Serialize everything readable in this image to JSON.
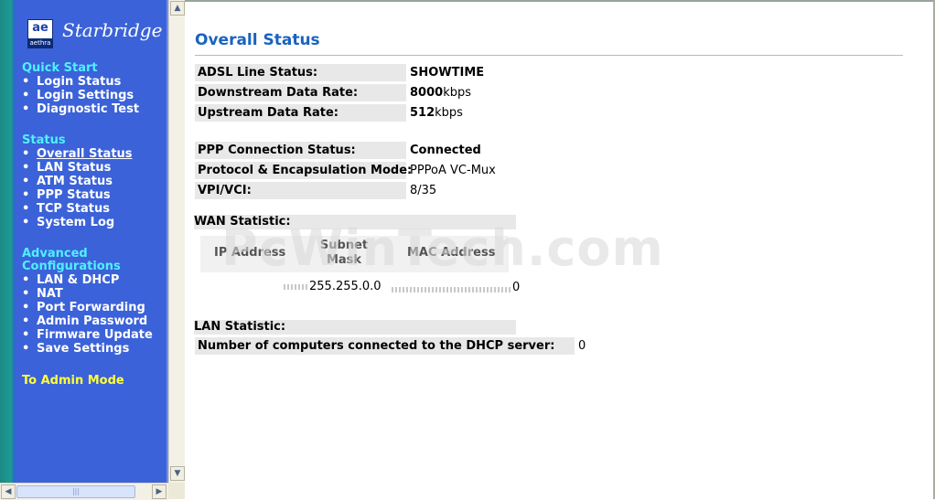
{
  "brand": {
    "logo_glyph": "ae",
    "logo_sub": "aethra",
    "name": "Starbridge"
  },
  "sidebar": {
    "quick_start": {
      "heading": "Quick Start",
      "items": [
        "Login Status",
        "Login Settings",
        "Diagnostic Test"
      ]
    },
    "status": {
      "heading": "Status",
      "items": [
        "Overall Status",
        "LAN Status",
        "ATM Status",
        "PPP Status",
        "TCP Status",
        "System Log"
      ],
      "active": "Overall Status"
    },
    "advanced": {
      "heading_line1": "Advanced",
      "heading_line2": "Configurations",
      "items": [
        "LAN & DHCP",
        "NAT",
        "Port Forwarding",
        "Admin Password",
        "Firmware Update",
        "Save Settings"
      ]
    },
    "admin_mode": "To Admin Mode",
    "bullet": "•"
  },
  "main": {
    "title": "Overall Status",
    "adsl": {
      "line_status_label": "ADSL Line Status:",
      "line_status_value": "SHOWTIME",
      "downstream_label": "Downstream Data Rate:",
      "downstream_value": "8000",
      "downstream_unit": "kbps",
      "upstream_label": "Upstream Data Rate:",
      "upstream_value": "512",
      "upstream_unit": "kbps"
    },
    "ppp": {
      "conn_label": "PPP Connection Status:",
      "conn_value": "Connected",
      "proto_label": "Protocol & Encapsulation Mode:",
      "proto_value": "PPPoA VC-Mux",
      "vpi_label": "VPI/VCI:",
      "vpi_value": "8/35"
    },
    "wan": {
      "heading": "WAN Statistic:",
      "col_ip": "IP Address",
      "col_subnet_1": "Subnet",
      "col_subnet_2": "Mask",
      "col_mac": "MAC Address",
      "subnet_value": "255.255.0.0",
      "mac_tail": "0"
    },
    "lan": {
      "heading": "LAN Statistic:",
      "dhcp_label": "Number of computers connected to the DHCP server:",
      "dhcp_value": "0"
    },
    "watermark": "PcWinTech.com"
  },
  "colors": {
    "sidebar_bg": "#3b62d8",
    "sidebar_heading": "#4ff0ff",
    "admin_link": "#fffe3a",
    "title": "#1863c0",
    "status_ok": "#118a11"
  }
}
